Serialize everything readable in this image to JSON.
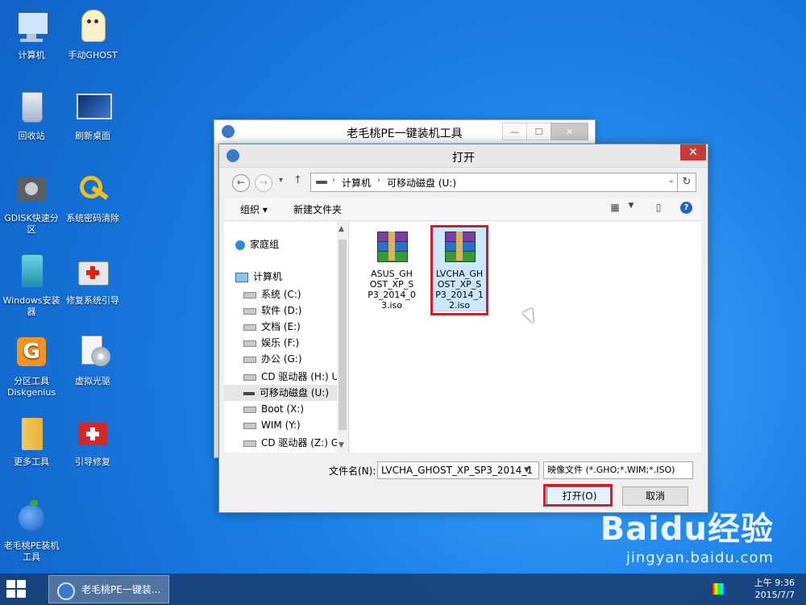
{
  "desktop": {
    "icons": [
      {
        "label": "计算机",
        "icon": "computer-icon"
      },
      {
        "label": "手动GHOST",
        "icon": "ghost-icon"
      },
      {
        "label": "回收站",
        "icon": "recycle-bin-icon"
      },
      {
        "label": "刷新桌面",
        "icon": "monitor-icon"
      },
      {
        "label": "GDISK快速分区",
        "icon": "disk-icon"
      },
      {
        "label": "系统密码清除",
        "icon": "key-icon"
      },
      {
        "label": "Windows安装器",
        "icon": "windows-installer-icon"
      },
      {
        "label": "修复系统引导",
        "icon": "first-aid-icon"
      },
      {
        "label": "分区工具Diskgenius",
        "icon": "diskgenius-icon"
      },
      {
        "label": "虚拟光驱",
        "icon": "virtual-drive-icon"
      },
      {
        "label": "更多工具",
        "icon": "folder-icon"
      },
      {
        "label": "引导修复",
        "icon": "toolbox-icon"
      },
      {
        "label": "老毛桃PE装机工具",
        "icon": "peach-icon"
      }
    ]
  },
  "back_window": {
    "title": "老毛桃PE一键装机工具"
  },
  "dialog": {
    "title": "打开",
    "address": {
      "crumbs": [
        "计算机",
        "可移动磁盘 (U:)"
      ]
    },
    "toolbar": {
      "organize": "组织",
      "new_folder": "新建文件夹"
    },
    "nav": {
      "items": [
        {
          "label": "家庭组",
          "icon": "homegroup-icon"
        },
        {
          "label": "计算机",
          "icon": "computer-icon"
        },
        {
          "label": "系统 (C:)",
          "icon": "drive-icon"
        },
        {
          "label": "软件 (D:)",
          "icon": "drive-icon"
        },
        {
          "label": "文档 (E:)",
          "icon": "drive-icon"
        },
        {
          "label": "娱乐 (F:)",
          "icon": "drive-icon"
        },
        {
          "label": "办公 (G:)",
          "icon": "drive-icon"
        },
        {
          "label": "CD 驱动器 (H:) U",
          "icon": "cd-drive-icon"
        },
        {
          "label": "可移动磁盘 (U:)",
          "icon": "usb-drive-icon"
        },
        {
          "label": "Boot (X:)",
          "icon": "drive-icon"
        },
        {
          "label": "WIM (Y:)",
          "icon": "drive-icon"
        },
        {
          "label": "CD 驱动器 (Z:) G",
          "icon": "cd-drive-icon"
        }
      ]
    },
    "files": [
      {
        "name_lines": [
          "ASUS_GH",
          "OST_XP_S",
          "P3_2014_0",
          "3.iso"
        ]
      },
      {
        "name_lines": [
          "LVCHA_GH",
          "OST_XP_S",
          "P3_2014_1",
          "2.iso"
        ]
      }
    ],
    "filename_label": "文件名(N):",
    "filename_value": "LVCHA_GHOST_XP_SP3_2014_1",
    "filetype_value": "映像文件 (*.GHO;*.WIM;*.ISO)",
    "open_button": "打开(O)",
    "cancel_button": "取消"
  },
  "taskbar": {
    "task_label": "老毛桃PE一键装...",
    "time": "上午 9:36",
    "date": "2015/7/7"
  },
  "watermark": {
    "line1": "Baidu经验",
    "line2": "jingyan.baidu.com"
  }
}
